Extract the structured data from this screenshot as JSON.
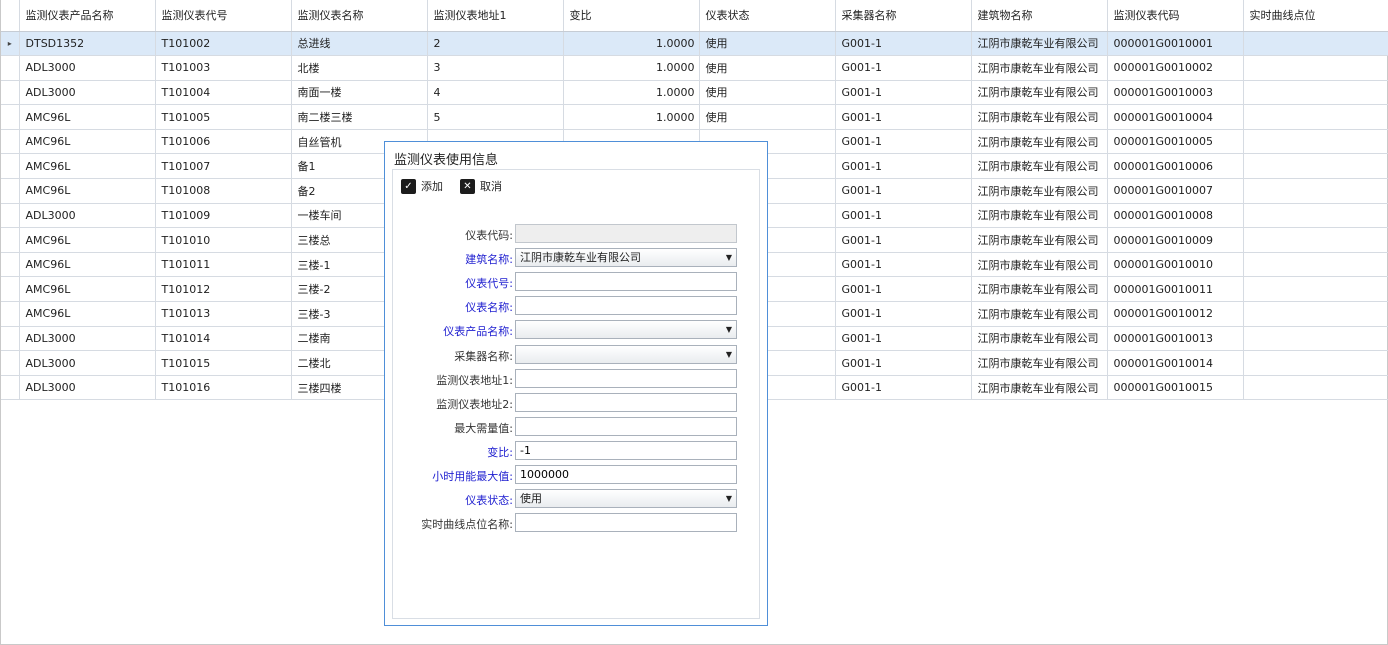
{
  "grid": {
    "columns": [
      "监测仪表产品名称",
      "监测仪表代号",
      "监测仪表名称",
      "监测仪表地址1",
      "变比",
      "仪表状态",
      "采集器名称",
      "建筑物名称",
      "监测仪表代码",
      "实时曲线点位"
    ],
    "row_indicator": "▸",
    "rows": [
      [
        "DTSD1352",
        "T101002",
        "总进线",
        "2",
        "1.0000",
        "使用",
        "G001-1",
        "江阴市康乾车业有限公司",
        "000001G0010001",
        ""
      ],
      [
        "ADL3000",
        "T101003",
        "北楼",
        "3",
        "1.0000",
        "使用",
        "G001-1",
        "江阴市康乾车业有限公司",
        "000001G0010002",
        ""
      ],
      [
        "ADL3000",
        "T101004",
        "南面一楼",
        "4",
        "1.0000",
        "使用",
        "G001-1",
        "江阴市康乾车业有限公司",
        "000001G0010003",
        ""
      ],
      [
        "AMC96L",
        "T101005",
        "南二楼三楼",
        "5",
        "1.0000",
        "使用",
        "G001-1",
        "江阴市康乾车业有限公司",
        "000001G0010004",
        ""
      ],
      [
        "AMC96L",
        "T101006",
        "自丝管机",
        "",
        "",
        "",
        "G001-1",
        "江阴市康乾车业有限公司",
        "000001G0010005",
        ""
      ],
      [
        "AMC96L",
        "T101007",
        "备1",
        "",
        "",
        "",
        "G001-1",
        "江阴市康乾车业有限公司",
        "000001G0010006",
        ""
      ],
      [
        "AMC96L",
        "T101008",
        "备2",
        "",
        "",
        "",
        "G001-1",
        "江阴市康乾车业有限公司",
        "000001G0010007",
        ""
      ],
      [
        "ADL3000",
        "T101009",
        "一楼车间",
        "",
        "",
        "",
        "G001-1",
        "江阴市康乾车业有限公司",
        "000001G0010008",
        ""
      ],
      [
        "AMC96L",
        "T101010",
        "三楼总",
        "",
        "",
        "",
        "G001-1",
        "江阴市康乾车业有限公司",
        "000001G0010009",
        ""
      ],
      [
        "AMC96L",
        "T101011",
        "三楼-1",
        "",
        "",
        "",
        "G001-1",
        "江阴市康乾车业有限公司",
        "000001G0010010",
        ""
      ],
      [
        "AMC96L",
        "T101012",
        "三楼-2",
        "",
        "",
        "",
        "G001-1",
        "江阴市康乾车业有限公司",
        "000001G0010011",
        ""
      ],
      [
        "AMC96L",
        "T101013",
        "三楼-3",
        "",
        "",
        "",
        "G001-1",
        "江阴市康乾车业有限公司",
        "000001G0010012",
        ""
      ],
      [
        "ADL3000",
        "T101014",
        "二楼南",
        "",
        "",
        "",
        "G001-1",
        "江阴市康乾车业有限公司",
        "000001G0010013",
        ""
      ],
      [
        "ADL3000",
        "T101015",
        "二楼北",
        "",
        "",
        "",
        "G001-1",
        "江阴市康乾车业有限公司",
        "000001G0010014",
        ""
      ],
      [
        "ADL3000",
        "T101016",
        "三楼四楼",
        "",
        "",
        "",
        "G001-1",
        "江阴市康乾车业有限公司",
        "000001G0010015",
        ""
      ]
    ],
    "selected_row": 0
  },
  "dialog": {
    "title": "监测仪表使用信息",
    "toolbar": {
      "add_label": "添加",
      "add_icon": "check-icon",
      "cancel_label": "取消",
      "cancel_icon": "close-icon"
    },
    "fields": [
      {
        "label": "仪表代码:",
        "kind": "input",
        "value": "",
        "required": false,
        "disabled": true
      },
      {
        "label": "建筑名称:",
        "kind": "select",
        "value": "江阴市康乾车业有限公司",
        "required": true
      },
      {
        "label": "仪表代号:",
        "kind": "input",
        "value": "",
        "required": true
      },
      {
        "label": "仪表名称:",
        "kind": "input",
        "value": "",
        "required": true
      },
      {
        "label": "仪表产品名称:",
        "kind": "select",
        "value": "",
        "required": true
      },
      {
        "label": "采集器名称:",
        "kind": "select",
        "value": "",
        "required": false
      },
      {
        "label": "监测仪表地址1:",
        "kind": "input",
        "value": "",
        "required": false
      },
      {
        "label": "监测仪表地址2:",
        "kind": "input",
        "value": "",
        "required": false
      },
      {
        "label": "最大需量值:",
        "kind": "input",
        "value": "",
        "required": false
      },
      {
        "label": "变比:",
        "kind": "input",
        "value": "-1",
        "required": true
      },
      {
        "label": "小时用能最大值:",
        "kind": "input",
        "value": "1000000",
        "required": true
      },
      {
        "label": "仪表状态:",
        "kind": "select",
        "value": "使用",
        "required": true
      },
      {
        "label": "实时曲线点位名称:",
        "kind": "input",
        "value": "",
        "required": false
      }
    ]
  },
  "colors": {
    "selected_row": "#dbe9f8",
    "dialog_border": "#4f8fd8",
    "required_label": "#2020d0"
  }
}
